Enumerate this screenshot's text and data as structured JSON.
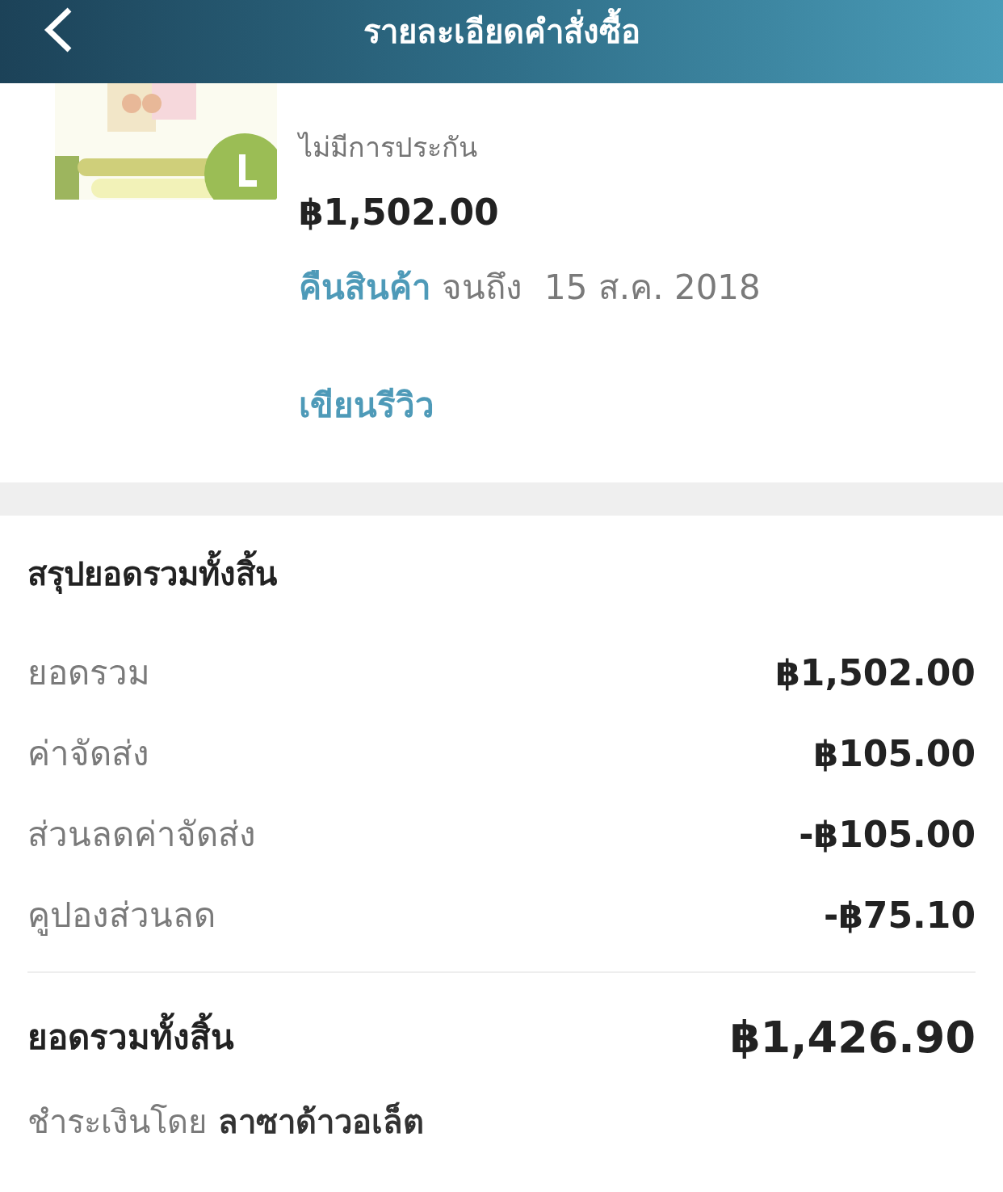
{
  "header": {
    "title": "รายละเอียดคำสั่งซื้อ"
  },
  "product": {
    "warranty": "ไม่มีการประกัน",
    "price": "฿1,502.00",
    "return_link": "คืนสินค้า",
    "return_until": "จนถึง",
    "return_date": "15 ส.ค. 2018",
    "review_link": "เขียนรีวิว"
  },
  "summary": {
    "title": "สรุปยอดรวมทั้งสิ้น",
    "rows": [
      {
        "label": "ยอดรวม",
        "value": "฿1,502.00"
      },
      {
        "label": "ค่าจัดส่ง",
        "value": "฿105.00"
      },
      {
        "label": "ส่วนลดค่าจัดส่ง",
        "value": "-฿105.00"
      },
      {
        "label": "คูปองส่วนลด",
        "value": "-฿75.10"
      }
    ],
    "total": {
      "label": "ยอดรวมทั้งสิ้น",
      "value": "฿1,426.90"
    },
    "payment": {
      "label": "ชำระเงินโดย",
      "value": "ลาซาด้าวอเล็ต"
    }
  }
}
